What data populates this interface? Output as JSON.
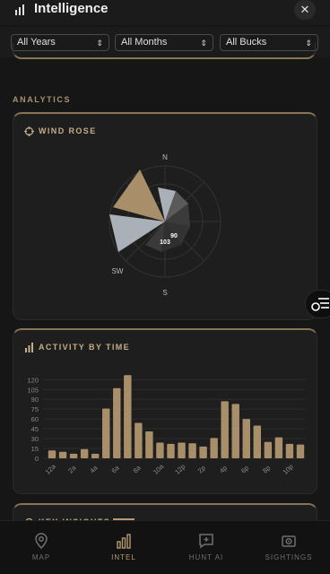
{
  "header": {
    "title": "Intelligence",
    "close_glyph": "✕"
  },
  "filters": [
    {
      "value": "All Years"
    },
    {
      "value": "All Months"
    },
    {
      "value": "All Bucks"
    }
  ],
  "section": {
    "label": "ANALYTICS"
  },
  "wind_rose": {
    "title": "WIND ROSE",
    "labels": {
      "n": "N",
      "sw": "SW",
      "s": "S"
    },
    "center_values": [
      "90",
      "103"
    ]
  },
  "activity": {
    "title": "ACTIVITY BY TIME"
  },
  "insights": {
    "title": "KEY INSIGHTS"
  },
  "chart_data": {
    "type": "bar",
    "categories": [
      "12a",
      "1a",
      "2a",
      "3a",
      "4a",
      "5a",
      "6a",
      "7a",
      "8a",
      "9a",
      "10a",
      "11a",
      "12p",
      "1p",
      "2p",
      "3p",
      "4p",
      "5p",
      "6p",
      "7p",
      "8p",
      "9p",
      "10p",
      "11p"
    ],
    "tick_labels": [
      "12a",
      "2a",
      "4a",
      "6a",
      "8a",
      "10a",
      "12p",
      "2p",
      "4p",
      "6p",
      "8p",
      "10p"
    ],
    "values": [
      12,
      10,
      7,
      14,
      7,
      76,
      107,
      127,
      54,
      41,
      24,
      22,
      24,
      23,
      18,
      31,
      87,
      83,
      60,
      50,
      25,
      32,
      22,
      21
    ],
    "yticks": [
      0,
      15,
      30,
      45,
      60,
      75,
      90,
      105,
      120
    ],
    "ylim": [
      0,
      130
    ],
    "bar_color": "#a98f69"
  },
  "nav": [
    {
      "label": "MAP",
      "icon": "map-pin-icon"
    },
    {
      "label": "INTEL",
      "icon": "bar-chart-icon"
    },
    {
      "label": "HUNT AI",
      "icon": "chat-plus-icon"
    },
    {
      "label": "SIGHTINGS",
      "icon": "camera-icon"
    }
  ],
  "active_nav": "INTEL",
  "colors": {
    "accent": "#a98f69",
    "background": "#161616",
    "card": "#1e1e1e"
  }
}
